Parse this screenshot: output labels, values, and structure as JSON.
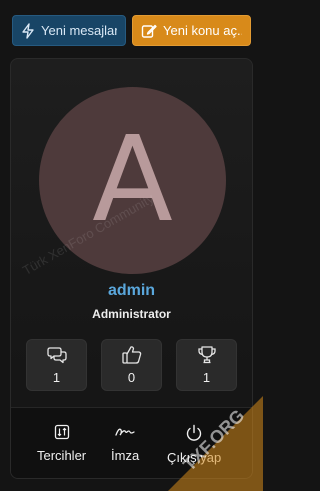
{
  "header": {
    "new_messages_label": "Yeni mesajlar",
    "new_thread_label": "Yeni konu aç..."
  },
  "profile": {
    "avatar_letter": "A",
    "username": "admin",
    "user_title": "Administrator",
    "stats": [
      {
        "icon": "messages-icon",
        "value": "1"
      },
      {
        "icon": "thumbs-up-icon",
        "value": "0"
      },
      {
        "icon": "trophy-icon",
        "value": "1"
      }
    ]
  },
  "footer": {
    "preferences_label": "Tercihler",
    "signature_label": "İmza",
    "logout_label": "Çıkış yap"
  },
  "watermark_text": "Türk XenForo Community",
  "corner_text": "TXF.ORG",
  "colors": {
    "accent_blue": "#184566",
    "accent_orange": "#d88a1a",
    "username": "#5aa7dc",
    "avatar_bg": "#4e3a3b"
  }
}
